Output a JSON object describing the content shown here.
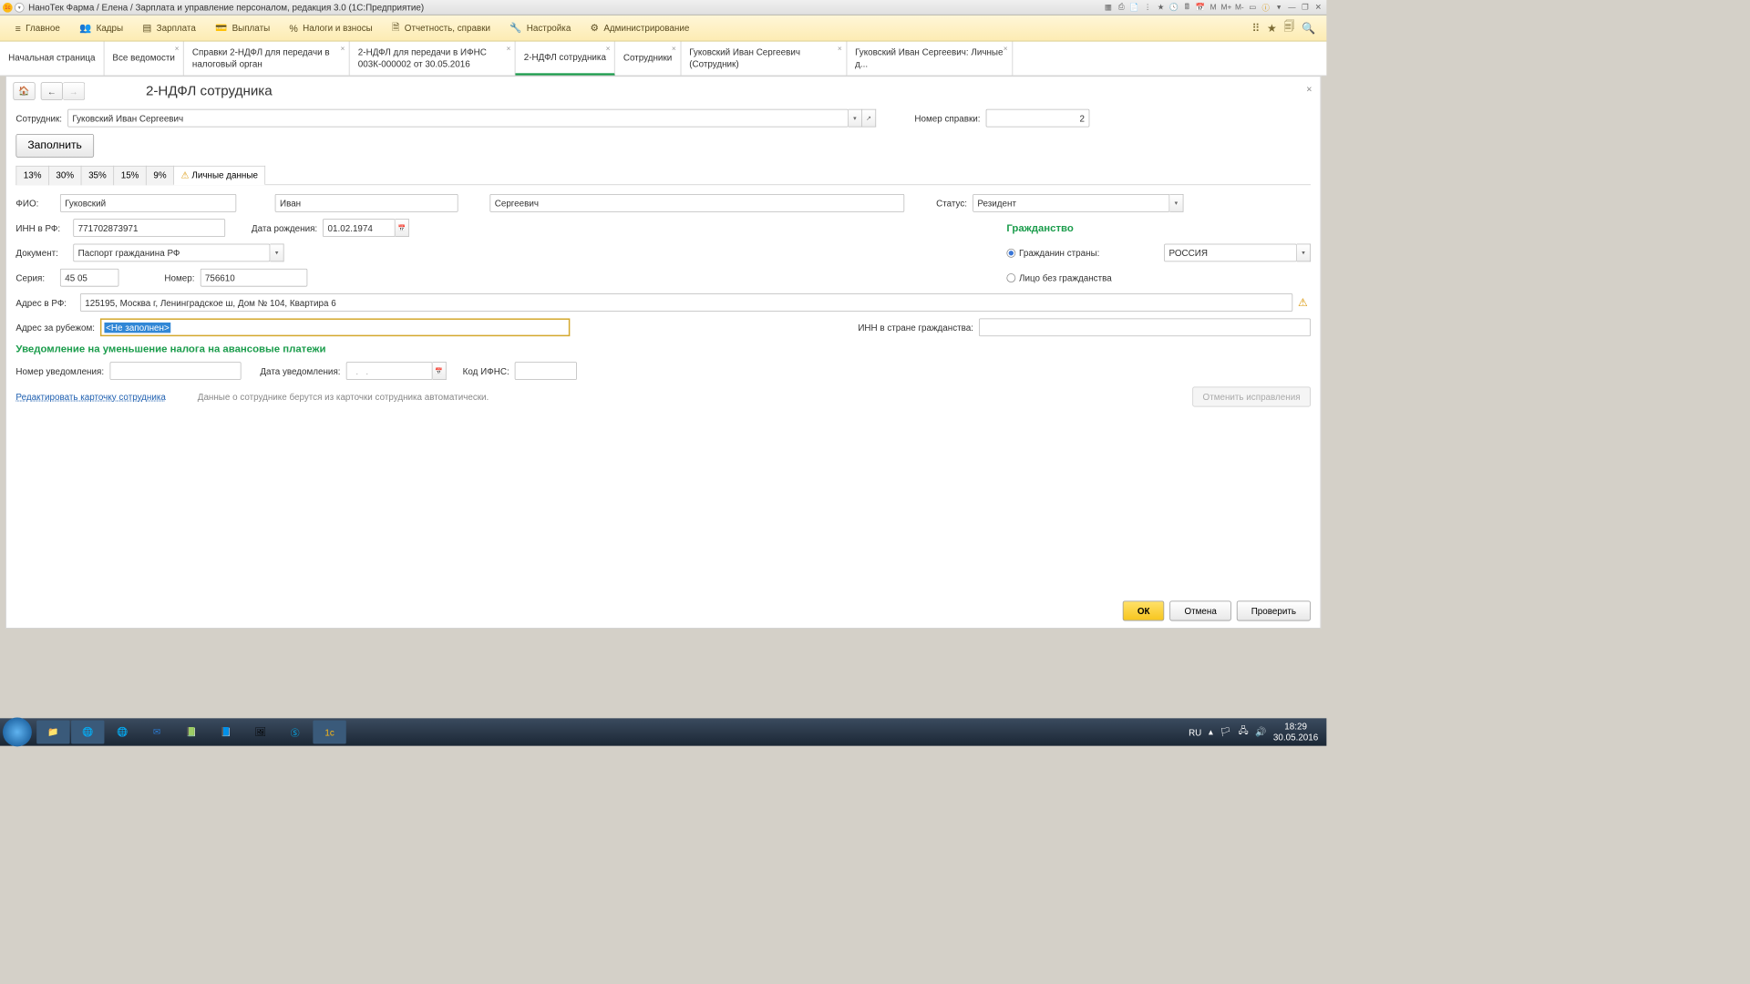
{
  "title": "НаноТек Фарма / Елена / Зарплата и управление персоналом, редакция 3.0 (1С:Предприятие)",
  "menu": {
    "m1": "Главное",
    "m2": "Кадры",
    "m3": "Зарплата",
    "m4": "Выплаты",
    "m5": "Налоги и взносы",
    "m6": "Отчетность, справки",
    "m7": "Настройка",
    "m8": "Администрирование"
  },
  "tabs": {
    "t0": "Начальная страница",
    "t1": "Все ведомости",
    "t2": "Справки 2-НДФЛ для передачи в налоговый орган",
    "t3": "2-НДФЛ для передачи в ИФНС 003К-000002 от 30.05.2016",
    "t4": "2-НДФЛ сотрудника",
    "t5": "Сотрудники",
    "t6": "Гуковский Иван Сергеевич (Сотрудник)",
    "t7": "Гуковский Иван Сергеевич: Личные д..."
  },
  "page": {
    "title": "2-НДФЛ сотрудника",
    "employee_lbl": "Сотрудник:",
    "employee": "Гуковский Иван Сергеевич",
    "refnum_lbl": "Номер справки:",
    "refnum": "2",
    "fill_btn": "Заполнить",
    "rates": {
      "r1": "13%",
      "r2": "30%",
      "r3": "35%",
      "r4": "15%",
      "r5": "9%",
      "r6": "Личные данные"
    },
    "fio_lbl": "ФИО:",
    "ln": "Гуковский",
    "fn": "Иван",
    "mn": "Сергеевич",
    "status_lbl": "Статус:",
    "status": "Резидент",
    "inn_lbl": "ИНН в РФ:",
    "inn": "771702873971",
    "dob_lbl": "Дата рождения:",
    "dob": "01.02.1974",
    "citiz_h": "Гражданство",
    "citiz_r1": "Гражданин страны:",
    "citiz_country": "РОССИЯ",
    "citiz_r2": "Лицо без гражданства",
    "doc_lbl": "Документ:",
    "doc": "Паспорт гражданина РФ",
    "ser_lbl": "Серия:",
    "ser": "45 05",
    "num_lbl": "Номер:",
    "num": "756610",
    "addr_lbl": "Адрес в РФ:",
    "addr": "125195, Москва г, Ленинградское ш, Дом № 104, Квартира 6",
    "addr2_lbl": "Адрес за рубежом:",
    "addr2": "<Не заполнен>",
    "inn2_lbl": "ИНН в стране гражданства:",
    "notif_h": "Уведомление на уменьшение налога на авансовые платежи",
    "notif_num_lbl": "Номер уведомления:",
    "notif_date_lbl": "Дата уведомления:",
    "notif_date": "  .   .",
    "ifns_lbl": "Код ИФНС:",
    "edit_link": "Редактировать карточку сотрудника",
    "info": "Данные о сотруднике берутся из карточки сотрудника автоматически.",
    "cancel_fix": "Отменить исправления",
    "ok": "ОК",
    "cancel": "Отмена",
    "check": "Проверить"
  },
  "tray": {
    "lang": "RU",
    "time": "18:29",
    "date": "30.05.2016"
  }
}
